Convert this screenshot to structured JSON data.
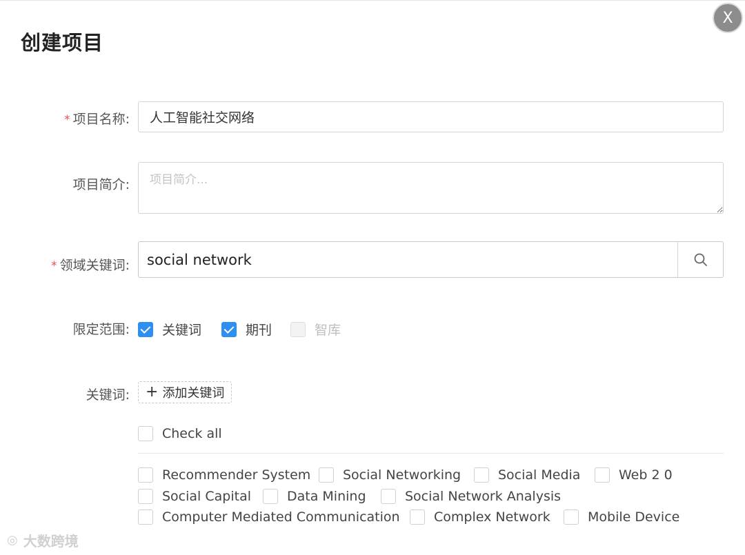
{
  "dialog": {
    "title": "创建项目",
    "close_label": "X"
  },
  "form": {
    "name": {
      "label": "项目名称:",
      "required_mark": "*",
      "value": "人工智能社交网络"
    },
    "intro": {
      "label": "项目简介:",
      "placeholder": "项目简介..."
    },
    "domain_keyword": {
      "label": "领域关键词:",
      "required_mark": "*",
      "value": "social network",
      "search_icon": "search-icon"
    },
    "scope": {
      "label": "限定范围:",
      "options": [
        {
          "label": "关键词",
          "checked": true,
          "disabled": false
        },
        {
          "label": "期刊",
          "checked": true,
          "disabled": false
        },
        {
          "label": "智库",
          "checked": false,
          "disabled": true
        }
      ]
    },
    "keywords": {
      "label": "关键词:",
      "add_label": "添加关键词",
      "check_all_label": "Check all",
      "items": [
        "Recommender System",
        "Social Networking",
        "Social Media",
        "Web 2 0",
        "Social Capital",
        "Data Mining",
        "Social Network Analysis",
        "Computer Mediated Communication",
        "Complex Network",
        "Mobile Device"
      ]
    }
  },
  "watermark": {
    "text": "大数跨境"
  },
  "colors": {
    "accent": "#2f8ff0",
    "required": "#e05252",
    "close_bg": "#8c8c8c"
  }
}
